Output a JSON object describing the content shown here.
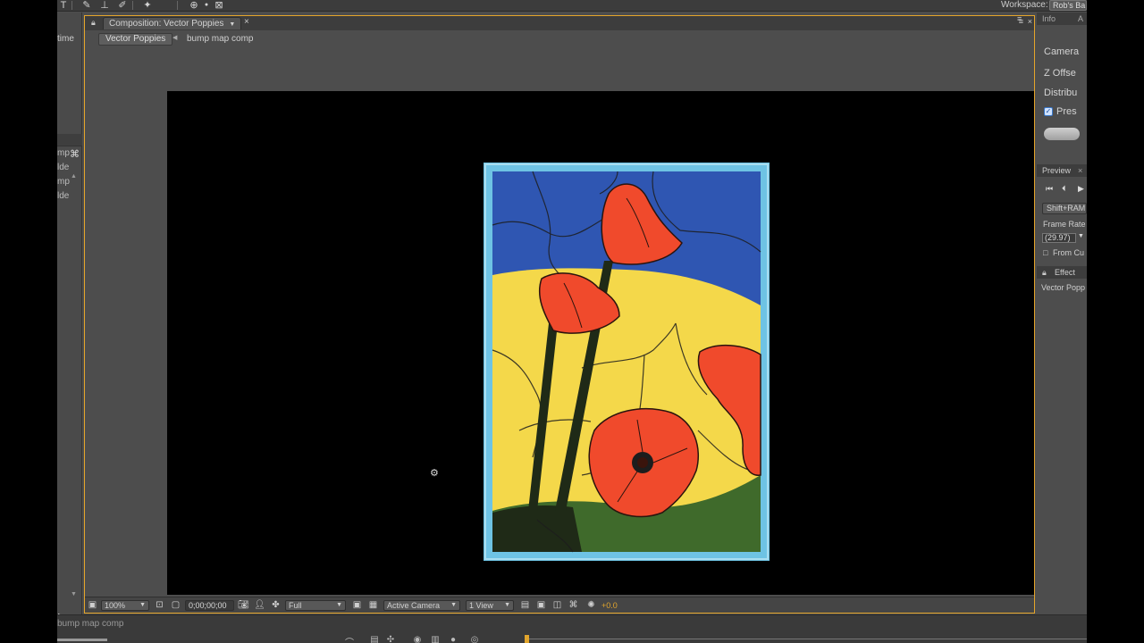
{
  "toolbar": {
    "tools": [
      "text-tool",
      "brush-tool",
      "clone-stamp-tool",
      "eraser-tool",
      "puppet-pin-tool",
      "axis-mode-local",
      "axis-mode-world",
      "axis-mode-view"
    ],
    "workspace_label": "Workspace:",
    "workspace_value": "Rob's Ba"
  },
  "timeline": {
    "tab_label": "time",
    "rows": [
      "mp",
      "lde",
      "mp",
      "lde"
    ]
  },
  "composition": {
    "tab_label": "Composition: Vector Poppies",
    "breadcrumb_active": "Vector Poppies",
    "breadcrumb_next": "bump map comp"
  },
  "footer": {
    "zoom": "100%",
    "timecode": "0;00;00;00",
    "resolution": "Full",
    "camera": "Active Camera",
    "view_layout": "1 View",
    "exposure": "+0.0"
  },
  "right_panel": {
    "info_tab": "Info",
    "audio_tab": "A",
    "camera_label": "Camera",
    "z_offset_label": "Z Offse",
    "distribute_label": "Distribu",
    "preserve_label": "Pres",
    "preview_tab": "Preview",
    "shift_ram_button": "Shift+RAM",
    "frame_rate_label": "Frame Rate",
    "frame_rate_value": "(29.97)",
    "from_current_label": "From Cu",
    "effects_tab": "Effect",
    "effects_item": "Vector Popp"
  },
  "bottom": {
    "tab_label": "bump map comp"
  },
  "colors": {
    "accent": "#e5a52a",
    "frame_blue": "#6ec3e4",
    "sky_blue": "#2f56b2",
    "field_yellow": "#f4d84a",
    "poppy_red": "#f04a2c",
    "grass_green": "#3f6a2b"
  }
}
